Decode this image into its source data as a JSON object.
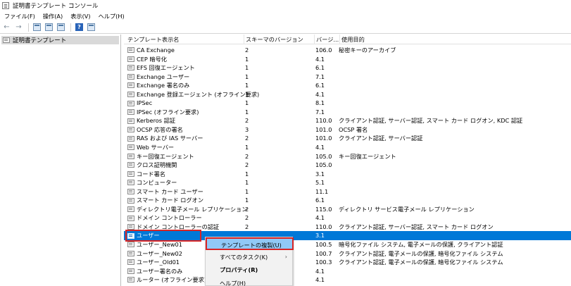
{
  "window": {
    "title": "証明書テンプレート コンソール"
  },
  "menu": {
    "items": [
      "ファイル(F)",
      "操作(A)",
      "表示(V)",
      "ヘルプ(H)"
    ]
  },
  "toolbar": {
    "icons": [
      "back-arrow-icon",
      "forward-arrow-icon",
      "console-tree-icon",
      "properties-icon",
      "export-icon",
      "help-icon",
      "view-icon"
    ]
  },
  "tree": {
    "root": "証明書テンプレート"
  },
  "table": {
    "columns": [
      "テンプレート表示名",
      "スキーマのバージョン",
      "バージ...",
      "使用目的"
    ],
    "rows": [
      [
        "CA Exchange",
        "2",
        "106.0",
        "秘密キーのアーカイブ"
      ],
      [
        "CEP 暗号化",
        "1",
        "4.1",
        ""
      ],
      [
        "EFS 回復エージェント",
        "1",
        "6.1",
        ""
      ],
      [
        "Exchange ユーザー",
        "1",
        "7.1",
        ""
      ],
      [
        "Exchange 署名のみ",
        "1",
        "6.1",
        ""
      ],
      [
        "Exchange 登録エージェント (オフライン要求)",
        "1",
        "4.1",
        ""
      ],
      [
        "IPSec",
        "1",
        "8.1",
        ""
      ],
      [
        "IPSec (オフライン要求)",
        "1",
        "7.1",
        ""
      ],
      [
        "Kerberos 認証",
        "2",
        "110.0",
        "クライアント認証, サーバー認証, スマート カード ログオン, KDC 認証"
      ],
      [
        "OCSP 応答の署名",
        "3",
        "101.0",
        "OCSP 署名"
      ],
      [
        "RAS および IAS サーバー",
        "2",
        "101.0",
        "クライアント認証, サーバー認証"
      ],
      [
        "Web サーバー",
        "1",
        "4.1",
        ""
      ],
      [
        "キー回復エージェント",
        "2",
        "105.0",
        "キー回復エージェント"
      ],
      [
        "クロス証明機関",
        "2",
        "105.0",
        ""
      ],
      [
        "コード署名",
        "1",
        "3.1",
        ""
      ],
      [
        "コンピューター",
        "1",
        "5.1",
        ""
      ],
      [
        "スマート カード ユーザー",
        "1",
        "11.1",
        ""
      ],
      [
        "スマート カード ログオン",
        "1",
        "6.1",
        ""
      ],
      [
        "ディレクトリ電子メール レプリケーション",
        "2",
        "115.0",
        "ディレクトリ サービス電子メール レプリケーション"
      ],
      [
        "ドメイン コントローラー",
        "2",
        "4.1",
        ""
      ],
      [
        "ドメイン コントローラーの認証",
        "2",
        "110.0",
        "クライアント認証, サーバー認証, スマート カード ログオン"
      ],
      [
        "ユーザー",
        "",
        "3.1",
        ""
      ],
      [
        "ユーザー_New01",
        "",
        "100.5",
        "暗号化ファイル システム, 電子メールの保護, クライアント認証"
      ],
      [
        "ユーザー_New02",
        "",
        "100.7",
        "クライアント認証, 電子メールの保護, 暗号化ファイル システム"
      ],
      [
        "ユーザー_Old01",
        "",
        "100.3",
        "クライアント認証, 電子メールの保護, 暗号化ファイル システム"
      ],
      [
        "ユーザー署名のみ",
        "",
        "4.1",
        ""
      ],
      [
        "ルーター (オフライン要求)",
        "",
        "4.1",
        ""
      ]
    ]
  },
  "context_menu": {
    "items": [
      "テンプレートの複製(U)",
      "すべてのタスク(K)",
      "プロパティ(R)",
      "ヘルプ(H)"
    ]
  },
  "colors": {
    "selection": "#0078d7",
    "highlight": "#d82525",
    "menu_hover": "#91c9f7"
  }
}
